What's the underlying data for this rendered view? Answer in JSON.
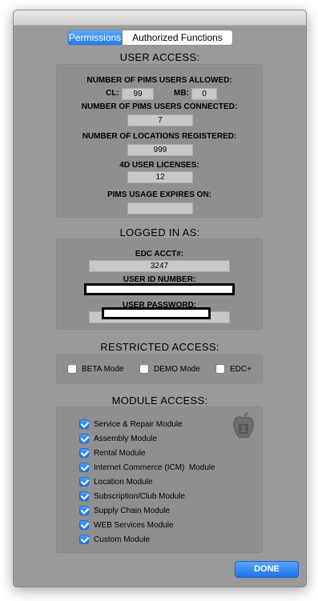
{
  "tabs": {
    "permissions": "Permissions",
    "authorized": "Authorized Functions"
  },
  "user_access": {
    "title": "USER ACCESS:",
    "allowed_label": "NUMBER OF PIMS USERS ALLOWED:",
    "cl_label": "CL:",
    "cl_value": "99",
    "mb_label": "MB:",
    "mb_value": "0",
    "connected_label": "NUMBER OF PIMS USERS CONNECTED:",
    "connected_value": "7",
    "locations_label": "NUMBER OF LOCATIONS REGISTERED:",
    "locations_value": "999",
    "licenses_label": "4D USER LICENSES:",
    "licenses_value": "12",
    "expires_label": "PIMS USAGE EXPIRES ON:",
    "expires_value": ""
  },
  "logged_in": {
    "title": "LOGGED IN AS:",
    "edc_label": "EDC ACCT#:",
    "edc_value": "3247",
    "user_id_label": "USER ID NUMBER:",
    "password_label": "USER PASSWORD:"
  },
  "restricted": {
    "title": "RESTRICTED ACCESS:",
    "items": [
      {
        "label": "BETA Mode",
        "checked": false
      },
      {
        "label": "DEMO Mode",
        "checked": false
      },
      {
        "label": "EDC+",
        "checked": false
      }
    ]
  },
  "modules": {
    "title": "MODULE ACCESS:",
    "items": [
      {
        "label": "Service & Repair Module",
        "checked": true
      },
      {
        "label": "Assembly Module",
        "checked": true
      },
      {
        "label": "Rental Module",
        "checked": true
      },
      {
        "label": "Internet Commerce (ICM)  Module",
        "checked": true
      },
      {
        "label": "Location Module",
        "checked": true
      },
      {
        "label": "Subscription/Club Module",
        "checked": true
      },
      {
        "label": "Supply Chain Module",
        "checked": true
      },
      {
        "label": "WEB Services Module",
        "checked": true
      },
      {
        "label": "Custom Module",
        "checked": true
      }
    ]
  },
  "done_label": "DONE",
  "colors": {
    "accent": "#1f7af0",
    "window_bg": "#9a9a9a",
    "panel_bg": "#8f8f8f"
  }
}
